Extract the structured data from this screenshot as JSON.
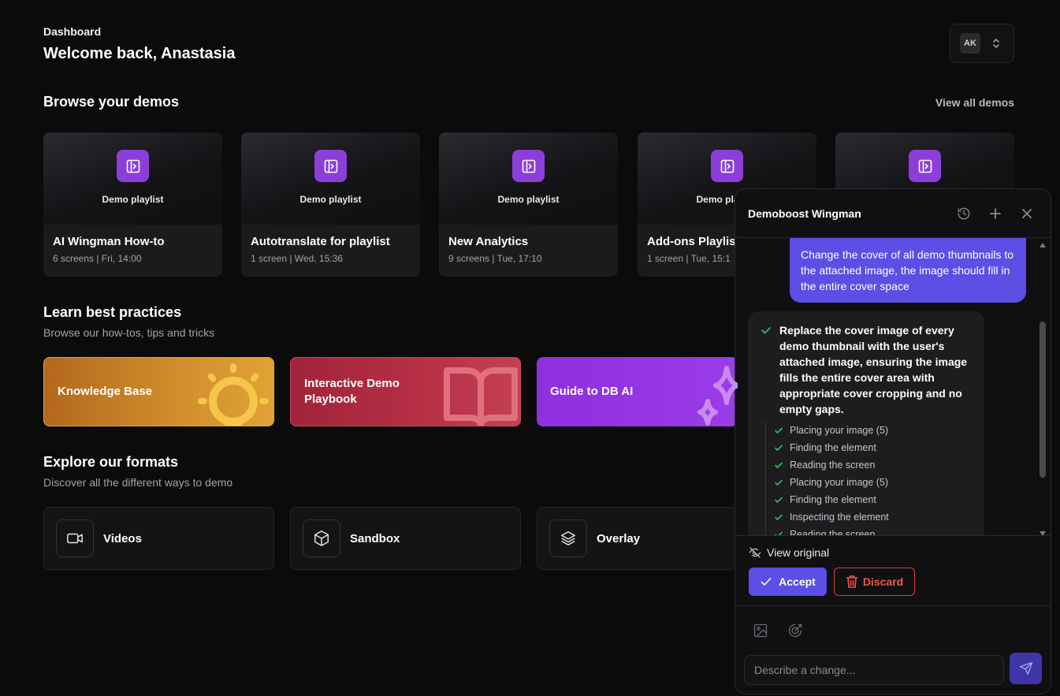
{
  "header": {
    "breadcrumb": "Dashboard",
    "welcome": "Welcome back, Anastasia",
    "user_initials": "AK"
  },
  "demos": {
    "title": "Browse your demos",
    "view_all": "View all demos",
    "thumb_label": "Demo playlist",
    "items": [
      {
        "title": "AI Wingman How-to",
        "meta": "6 screens | Fri, 14:00"
      },
      {
        "title": "Autotranslate for playlist",
        "meta": "1 screen | Wed, 15:36"
      },
      {
        "title": "New Analytics",
        "meta": "9 screens | Tue, 17:10"
      },
      {
        "title": "Add-ons Playlist",
        "meta": "1 screen | Tue, 15:1"
      },
      {
        "title": "",
        "meta": ""
      }
    ]
  },
  "learn": {
    "title": "Learn best practices",
    "subtitle": "Browse our how-tos, tips and tricks",
    "items": [
      {
        "label": "Knowledge Base",
        "color": "#c9771f"
      },
      {
        "label": "Interactive Demo Playbook",
        "color": "#b0283f"
      },
      {
        "label": "Guide to DB AI",
        "color": "#9333ea"
      }
    ]
  },
  "formats": {
    "title": "Explore our formats",
    "subtitle": "Discover all the different ways to demo",
    "items": [
      {
        "label": "Videos",
        "icon": "video-icon"
      },
      {
        "label": "Sandbox",
        "icon": "box-icon"
      },
      {
        "label": "Overlay",
        "icon": "layers-icon"
      }
    ]
  },
  "wingman": {
    "title": "Demoboost Wingman",
    "user_message": "Change the cover of all demo thumbnails to the attached image, the image should fill in the entire cover space",
    "ai_summary": "Replace the cover image of every demo thumbnail with the user's attached image, ensuring the image fills the entire cover area with appropriate cover cropping and no empty gaps.",
    "steps": [
      "Placing your image (5)",
      "Finding the element",
      "Reading the screen",
      "Placing your image (5)",
      "Finding the element",
      "Inspecting the element",
      "Reading the screen"
    ],
    "view_original": "View original",
    "accept": "Accept",
    "discard": "Discard",
    "input_placeholder": "Describe a change...",
    "accent": "#5b4fe6"
  }
}
